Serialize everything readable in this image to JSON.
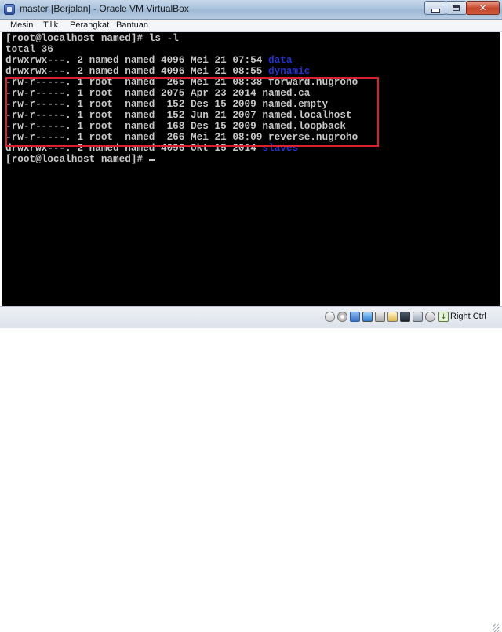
{
  "window": {
    "title": "master [Berjalan] - Oracle VM VirtualBox"
  },
  "menu": {
    "items": [
      "Mesin",
      "Tilik",
      "Perangkat",
      "Bantuan"
    ]
  },
  "terminal": {
    "prompt1": "[root@localhost named]# ls -l",
    "total": "total 36",
    "rows": [
      {
        "prefix": "drwxrwx---. 2 named named 4096 Mei 21 07:54 ",
        "name": "data",
        "is_dir": true
      },
      {
        "prefix": "drwxrwx---. 2 named named 4096 Mei 21 08:55 ",
        "name": "dynamic",
        "is_dir": true
      },
      {
        "prefix": "-rw-r-----. 1 root  named  265 Mei 21 08:38 ",
        "name": "forward.nugroho",
        "is_dir": false
      },
      {
        "prefix": "-rw-r-----. 1 root  named 2075 Apr 23 2014 ",
        "name": "named.ca",
        "is_dir": false
      },
      {
        "prefix": "-rw-r-----. 1 root  named  152 Des 15 2009 ",
        "name": "named.empty",
        "is_dir": false
      },
      {
        "prefix": "-rw-r-----. 1 root  named  152 Jun 21 2007 ",
        "name": "named.localhost",
        "is_dir": false
      },
      {
        "prefix": "-rw-r-----. 1 root  named  168 Des 15 2009 ",
        "name": "named.loopback",
        "is_dir": false
      },
      {
        "prefix": "-rw-r-----. 1 root  named  266 Mei 21 08:09 ",
        "name": "reverse.nugroho",
        "is_dir": false
      },
      {
        "prefix": "drwxrwx---. 2 named named 4096 Okt 15 2014 ",
        "name": "slaves",
        "is_dir": true
      }
    ],
    "prompt2": "[root@localhost named]# "
  },
  "statusbar": {
    "right_ctrl": "Right Ctrl"
  },
  "colors": {
    "terminal_bg": "#000000",
    "terminal_fg": "#c8c8c8",
    "dir_fg": "#2233cc",
    "highlight": "#d9202c"
  }
}
